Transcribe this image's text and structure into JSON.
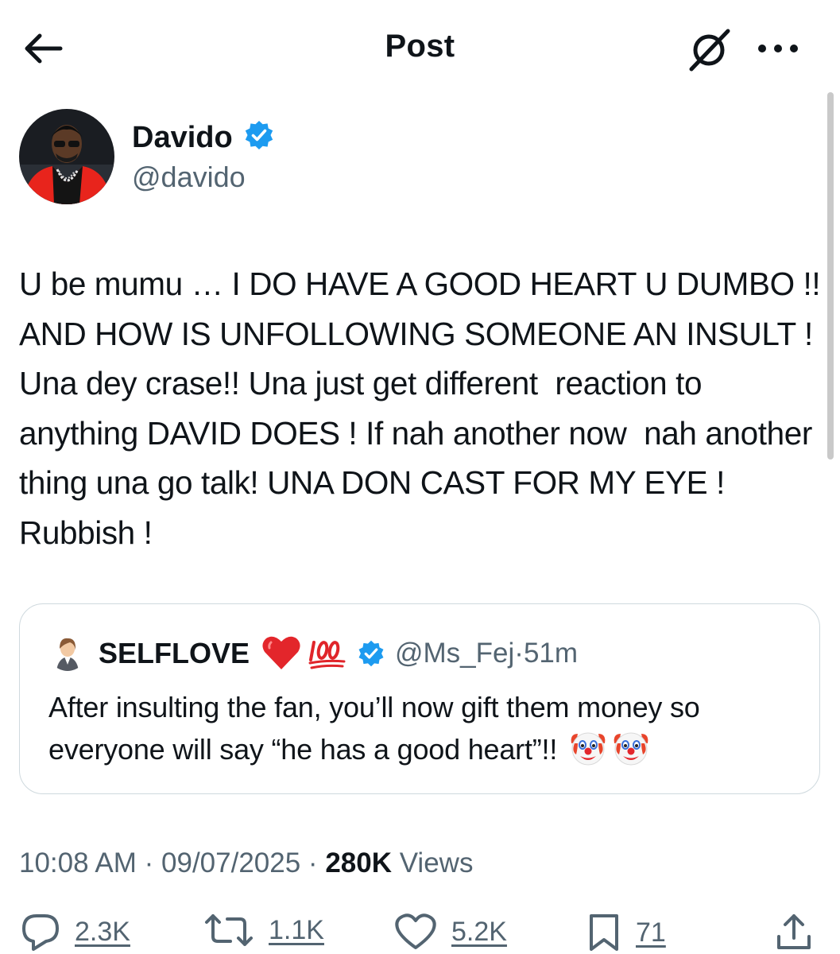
{
  "header": {
    "title": "Post",
    "back_icon": "arrow-left-icon",
    "grok_icon": "grok-icon",
    "more_icon": "more-horizontal-icon"
  },
  "author": {
    "name": "Davido",
    "handle": "@davido",
    "verified": true,
    "badge_color": "#1d9bf0"
  },
  "tweet": {
    "text": "U be mumu … I DO HAVE A GOOD HEART U DUMBO !! AND HOW IS UNFOLLOWING SOMEONE AN INSULT ! Una dey crase!! Una just get different  reaction to anything DAVID DOES ! If nah another now  nah another thing una go talk! UNA DON CAST FOR MY EYE ! Rubbish !"
  },
  "quote": {
    "name": "SELFLOVE",
    "name_emojis": [
      "heart-emoji",
      "hundred-points-emoji"
    ],
    "verified": true,
    "handle": "@Ms_Fej",
    "separator": "·",
    "time": "51m",
    "text": "After insulting the fan, you’ll now gift them money so everyone will say “he has a good heart”!!",
    "text_emojis": [
      "clown-face-emoji",
      "clown-face-emoji"
    ]
  },
  "meta": {
    "time": "10:08 AM",
    "separator": "·",
    "date": "09/07/2025",
    "views_count": "280K",
    "views_label": "Views"
  },
  "actions": {
    "replies": "2.3K",
    "reposts": "1.1K",
    "likes": "5.2K",
    "bookmarks": "71",
    "icons": [
      "reply-icon",
      "repost-icon",
      "like-icon",
      "bookmark-icon",
      "share-icon"
    ]
  },
  "colors": {
    "text": "#0f1419",
    "secondary": "#536471",
    "border": "#cfd9de",
    "verified": "#1d9bf0"
  }
}
